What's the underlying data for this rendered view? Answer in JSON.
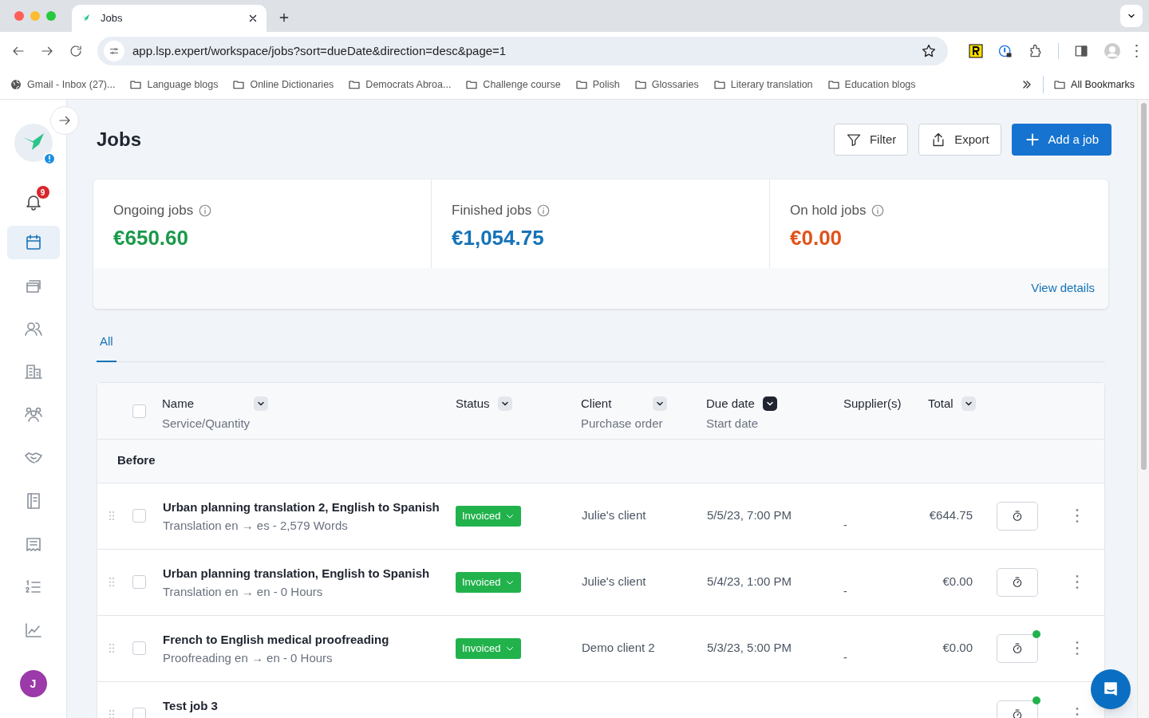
{
  "browser": {
    "tab_title": "Jobs",
    "url": "app.lsp.expert/workspace/jobs?sort=dueDate&direction=desc&page=1",
    "bookmarks": [
      {
        "kind": "site",
        "label": "Gmail - Inbox (27)..."
      },
      {
        "kind": "folder",
        "label": "Language blogs"
      },
      {
        "kind": "folder",
        "label": "Online Dictionaries"
      },
      {
        "kind": "folder",
        "label": "Democrats Abroa..."
      },
      {
        "kind": "folder",
        "label": "Challenge course"
      },
      {
        "kind": "folder",
        "label": "Polish"
      },
      {
        "kind": "folder",
        "label": "Glossaries"
      },
      {
        "kind": "folder",
        "label": "Literary translation"
      },
      {
        "kind": "folder",
        "label": "Education blogs"
      }
    ],
    "all_bookmarks": "All Bookmarks"
  },
  "sidebar": {
    "notification_count": "9",
    "avatar_initials": "J",
    "items": [
      {
        "kind": "calendar",
        "selected": true
      },
      {
        "kind": "windows",
        "selected": false
      },
      {
        "kind": "people",
        "selected": false
      },
      {
        "kind": "building",
        "selected": false
      },
      {
        "kind": "team",
        "selected": false
      },
      {
        "kind": "handshake",
        "selected": false
      },
      {
        "kind": "book",
        "selected": false
      },
      {
        "kind": "receipt",
        "selected": false
      },
      {
        "kind": "numbered-list",
        "selected": false
      },
      {
        "kind": "chart",
        "selected": false
      }
    ]
  },
  "page": {
    "title": "Jobs",
    "buttons": [
      {
        "kind": "filter",
        "label": "Filter"
      },
      {
        "kind": "export",
        "label": "Export"
      },
      {
        "kind": "add",
        "label": "Add a job"
      }
    ]
  },
  "summary": {
    "cards": [
      {
        "label": "Ongoing jobs",
        "value": "€650.60",
        "color": "#1a9a4a"
      },
      {
        "label": "Finished jobs",
        "value": "€1,054.75",
        "color": "#1673b8"
      },
      {
        "label": "On hold jobs",
        "value": "€0.00",
        "color": "#e0541b"
      }
    ],
    "link": "View details"
  },
  "tabs": [
    {
      "label": "All",
      "selected": true
    }
  ],
  "table": {
    "select_all_checked": false,
    "columns": [
      {
        "label": "Name",
        "sublabel": "Service/Quantity",
        "sorted": false
      },
      {
        "label": "Status",
        "sorted": false
      },
      {
        "label": "Client",
        "sublabel": "Purchase order",
        "sorted": false
      },
      {
        "label": "Due date",
        "sublabel": "Start date",
        "sorted": true
      },
      {
        "label": "Supplier(s)"
      },
      {
        "label": "Total",
        "sorted": false
      }
    ],
    "group": "Before",
    "rows": [
      {
        "name": "Urban planning translation 2, English to Spanish",
        "service": "Translation en → es - 2,579 Words",
        "status": "Invoiced",
        "client": "Julie's client",
        "due": "5/5/23, 7:00 PM",
        "suppliers": "-",
        "total": "€644.75",
        "checked": false,
        "timer_active": false
      },
      {
        "name": "Urban planning translation, English to Spanish",
        "service": "Translation en → en - 0 Hours",
        "status": "Invoiced",
        "client": "Julie's client",
        "due": "5/4/23, 1:00 PM",
        "suppliers": "-",
        "total": "€0.00",
        "checked": false,
        "timer_active": false
      },
      {
        "name": "French to English medical proofreading",
        "service": "Proofreading en → en - 0 Hours",
        "status": "Invoiced",
        "client": "Demo client 2",
        "due": "5/3/23, 5:00 PM",
        "suppliers": "-",
        "total": "€0.00",
        "checked": false,
        "timer_active": true
      },
      {
        "name": "Test job 3",
        "checked": false,
        "timer_active": true
      }
    ]
  }
}
